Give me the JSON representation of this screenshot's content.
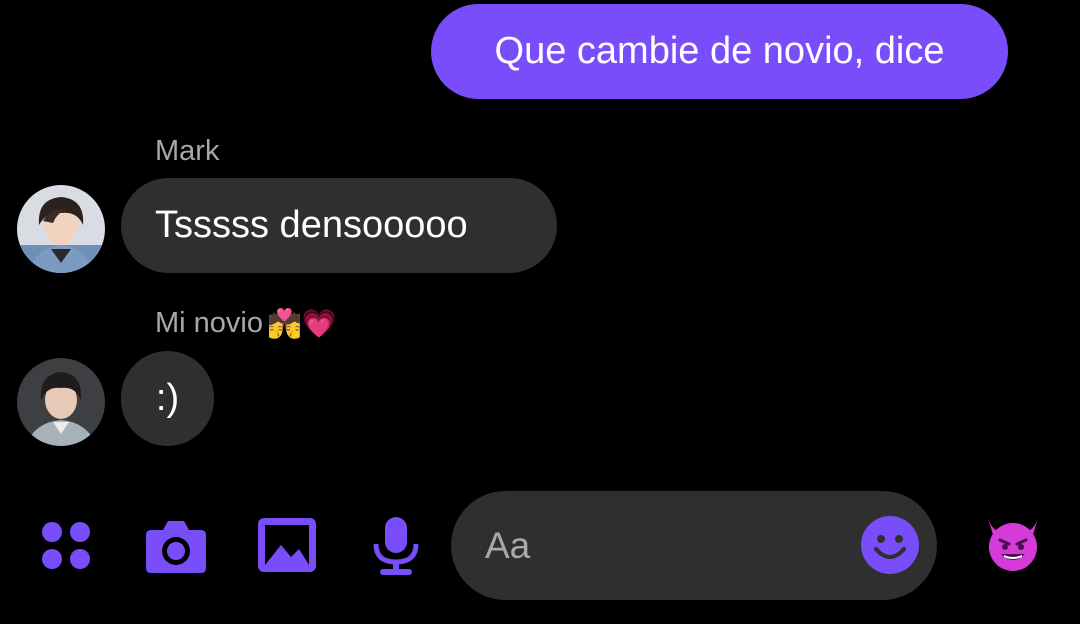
{
  "messages": {
    "outgoing": {
      "text": "Que cambie de novio, dice"
    },
    "incoming": [
      {
        "sender": "Mark",
        "text": "Tsssss densooooo"
      },
      {
        "sender": "Mi novio",
        "sender_emojis": "💏💗",
        "text": ":)"
      }
    ]
  },
  "composer": {
    "placeholder": "Aa",
    "value": ""
  },
  "toolbar": {
    "icons": [
      "apps-icon",
      "camera-icon",
      "gallery-icon",
      "microphone-icon",
      "emoji-icon",
      "quick-reaction-devil-icon"
    ]
  },
  "colors": {
    "accent": "#7a4dfb",
    "bubble_incoming": "#2f2f2f",
    "background": "#000000",
    "quick_reaction": "#d63bd9"
  }
}
